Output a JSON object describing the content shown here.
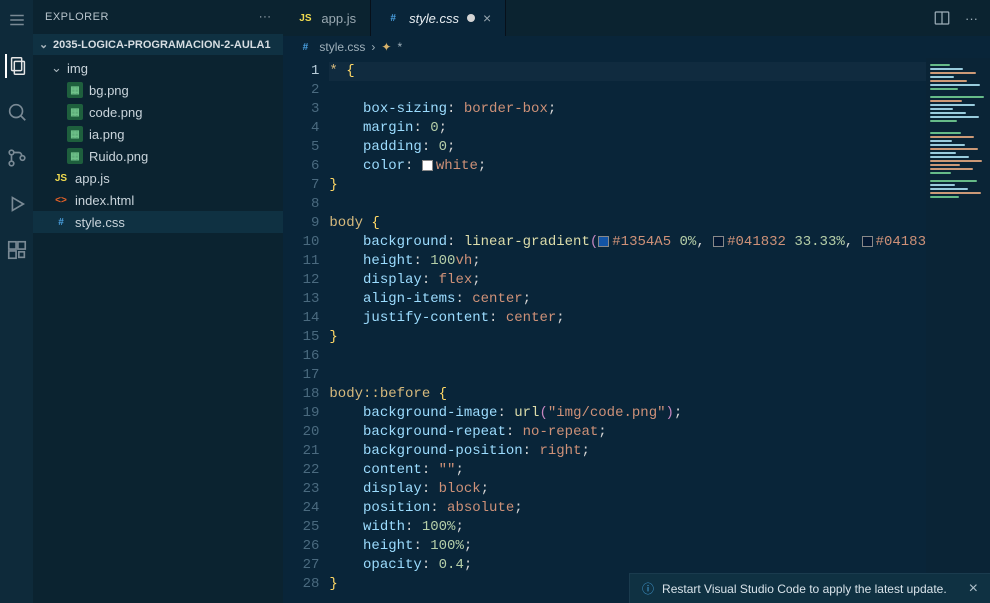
{
  "sidebar": {
    "title": "EXPLORER",
    "project": "2035-LOGICA-PROGRAMACION-2-AULA1",
    "folder": {
      "name": "img",
      "open": true
    },
    "img_files": [
      {
        "name": "bg.png"
      },
      {
        "name": "code.png"
      },
      {
        "name": "ia.png"
      },
      {
        "name": "Ruido.png"
      }
    ],
    "root_files": [
      {
        "name": "app.js",
        "kind": "js"
      },
      {
        "name": "index.html",
        "kind": "html"
      },
      {
        "name": "style.css",
        "kind": "css"
      }
    ]
  },
  "tabs": [
    {
      "label": "app.js",
      "kind": "js",
      "active": false,
      "modified": false
    },
    {
      "label": "style.css",
      "kind": "css",
      "active": true,
      "modified": true
    }
  ],
  "breadcrumb": {
    "file": "style.css",
    "symbol": "*"
  },
  "editor": {
    "current_line": 1,
    "gradient": {
      "c1": "#1354A5",
      "p1": "0%",
      "c2": "#041832",
      "p2": "33.33%",
      "c3": "#04183"
    },
    "bg_url": "\"img/code.png\""
  },
  "notification": {
    "text": "Restart Visual Studio Code to apply the latest update."
  }
}
